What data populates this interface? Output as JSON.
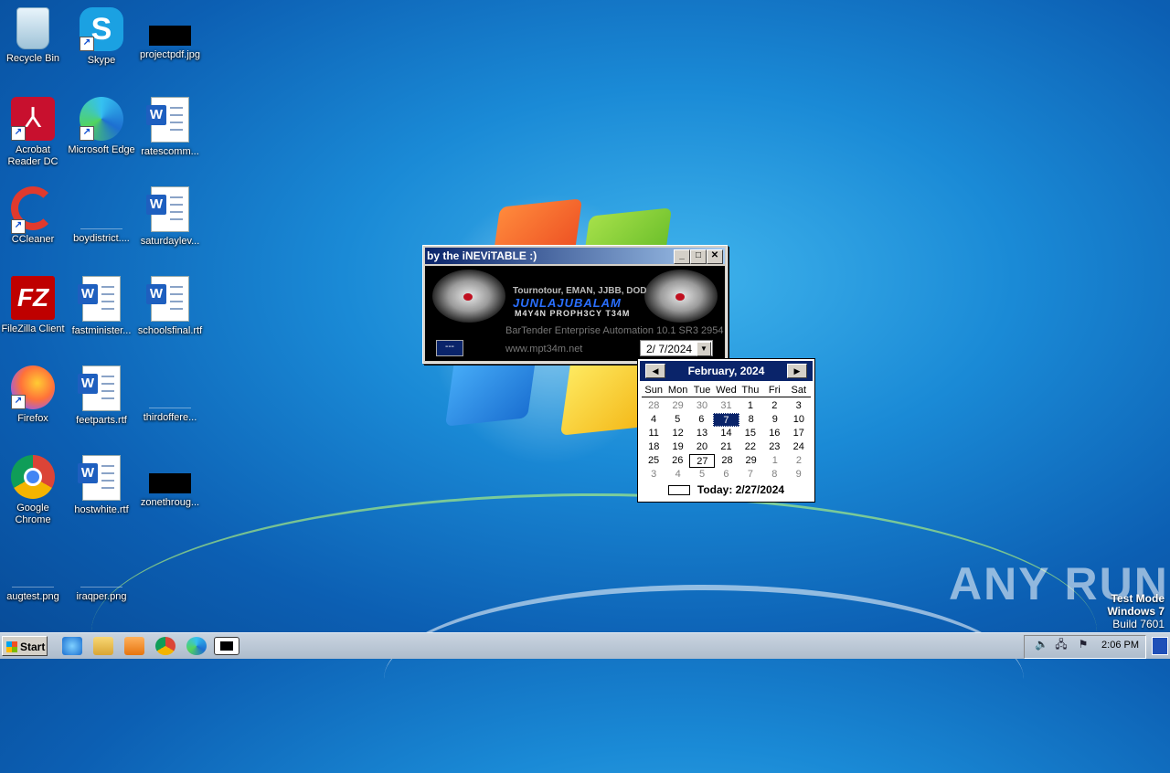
{
  "desktop": {
    "icons": [
      {
        "label": "Recycle Bin"
      },
      {
        "label": "Skype"
      },
      {
        "label": "projectpdf.jpg"
      },
      {
        "label": "Acrobat Reader DC"
      },
      {
        "label": "Microsoft Edge"
      },
      {
        "label": "ratescomm..."
      },
      {
        "label": "CCleaner"
      },
      {
        "label": "boydistrict...."
      },
      {
        "label": "saturdaylev..."
      },
      {
        "label": "FileZilla Client"
      },
      {
        "label": "fastminister..."
      },
      {
        "label": "schoolsfinal.rtf"
      },
      {
        "label": "Firefox"
      },
      {
        "label": "feetparts.rtf"
      },
      {
        "label": "thirdoffere..."
      },
      {
        "label": "Google Chrome"
      },
      {
        "label": "hostwhite.rtf"
      },
      {
        "label": "zonethroug..."
      },
      {
        "label": "augtest.png"
      },
      {
        "label": "iraqper.png"
      }
    ]
  },
  "window": {
    "title": "by the iNEViTABLE :)",
    "minimize": "_",
    "maximize": "□",
    "close": "✕",
    "banner_small": "Tournotour, EMAN, JJBB, DOD",
    "banner_big": "JUNLAJUBALAM",
    "banner_crew": "M4Y4N PROPH3CY T34M",
    "product": "BarTender Enterprise Automation 10.1 SR3 2954",
    "url": "www.mpt34m.net",
    "dash_button": "---",
    "date_value": "2/  7/2024"
  },
  "calendar": {
    "month": "February, 2024",
    "days_of_week": [
      "Sun",
      "Mon",
      "Tue",
      "Wed",
      "Thu",
      "Fri",
      "Sat"
    ],
    "weeks": [
      [
        "28",
        "29",
        "30",
        "31",
        "1",
        "2",
        "3"
      ],
      [
        "4",
        "5",
        "6",
        "7",
        "8",
        "9",
        "10"
      ],
      [
        "11",
        "12",
        "13",
        "14",
        "15",
        "16",
        "17"
      ],
      [
        "18",
        "19",
        "20",
        "21",
        "22",
        "23",
        "24"
      ],
      [
        "25",
        "26",
        "27",
        "28",
        "29",
        "1",
        "2"
      ],
      [
        "3",
        "4",
        "5",
        "6",
        "7",
        "8",
        "9"
      ]
    ],
    "selected_day": "7",
    "today_day": "27",
    "today_label": "Today: 2/27/2024"
  },
  "watermark": {
    "brand": "ANY RUN",
    "line1": "Test Mode",
    "line2": "Windows 7",
    "line3": "Build 7601"
  },
  "taskbar": {
    "start_label": "Start",
    "clock": "2:06 PM",
    "colors": {
      "accent": "#0a246a"
    }
  }
}
